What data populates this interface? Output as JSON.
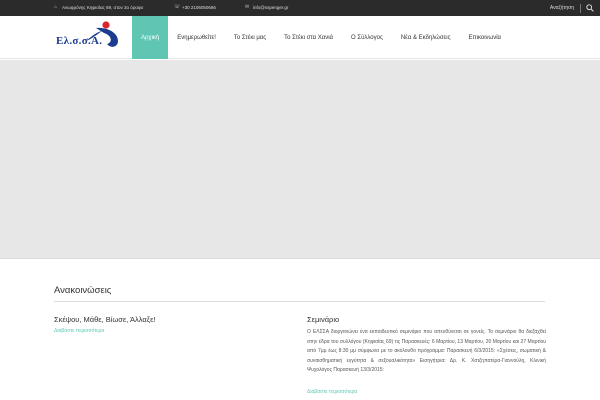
{
  "topbar": {
    "address": "Ανωφρόνης Κηφισίας 69, στον 3ο όροφο",
    "phone": "+30 2106050666",
    "email": "info@sspenger.gr",
    "search_label": "Αναζήτηση"
  },
  "header": {
    "logo_text": "Ελ.σ.σ.Α.",
    "nav": [
      {
        "label": "Αρχική",
        "active": true
      },
      {
        "label": "Ενημερωθείτε!",
        "active": false
      },
      {
        "label": "Το Στέκι μας",
        "active": false
      },
      {
        "label": "Το Στέκι στα Χανιά",
        "active": false
      },
      {
        "label": "Ο Σύλλογος",
        "active": false
      },
      {
        "label": "Νέα & Εκδηλώσεις",
        "active": false
      },
      {
        "label": "Επικοινωνία",
        "active": false
      }
    ]
  },
  "announcements": {
    "title": "Ανακοινώσεις",
    "left_post": {
      "title": "Σκέψου, Μάθε, Βίωσε, Άλλαξε!",
      "more": "Διαβάστε περισσότερα"
    },
    "right_post": {
      "title": "Σεμινάριο",
      "body": "Ο ΕΛΣΣΑ διοργανώνει ένα εκπαιδευτικό σεμινάριο που απευθύνεται σε γονείς. Το σεμινάριο θα διεξαχθεί στην έδρα του συλλόγου (Κηφισίας 69) τις Παρασκευές: 6 Μαρτίου, 13 Μαρτίου, 20 Μαρτίου και 27 Μαρτίου από 7μμ έως 8:30 μμ σύμφωνα με το ακόλουθο πρόγραμμα: Παρασκευή 6/3/2015: «Σχέσεις, σωματική & συναισθηματική εγγύτητα & σεξουαλικότητα» Εισηγήτρια: Δρ. Κ. Χατζηπατέρα-Γιαννούλη, Κλινική Ψυχολόγος Παρασκευή 13/3/2015:",
      "more": "Διαβάστε περισσότερα"
    }
  },
  "colors": {
    "accent": "#5fc6b3",
    "topbar_bg": "#2b2b2b",
    "hero_bg": "#e7e7e7",
    "logo_blue": "#1b3d8f",
    "logo_red": "#d9262e"
  },
  "icons": {
    "address": "home-icon",
    "phone": "phone-icon",
    "email": "envelope-icon",
    "search": "search-icon"
  }
}
